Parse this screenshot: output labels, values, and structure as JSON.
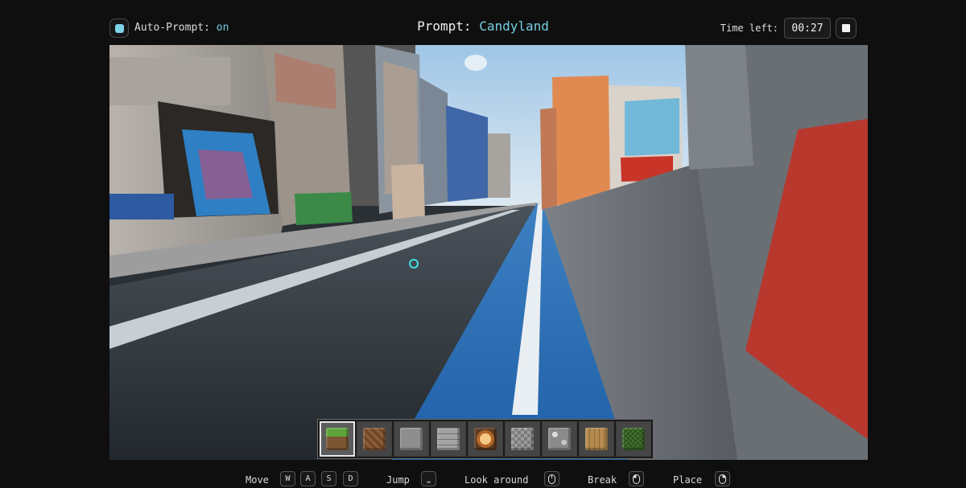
{
  "top_bar": {
    "auto_prompt_label": "Auto-Prompt:",
    "auto_prompt_value": "on",
    "prompt_label": "Prompt:",
    "prompt_value": "Candyland",
    "time_label": "Time left:",
    "time_value": "00:27"
  },
  "hotbar": {
    "selected_index": 0,
    "slots": [
      {
        "icon": "grass-block-icon"
      },
      {
        "icon": "dirt-block-icon"
      },
      {
        "icon": "stone-block-icon"
      },
      {
        "icon": "stone-brick-block-icon"
      },
      {
        "icon": "glowstone-block-icon"
      },
      {
        "icon": "cobblestone-block-icon"
      },
      {
        "icon": "ore-block-icon"
      },
      {
        "icon": "wood-plank-block-icon"
      },
      {
        "icon": "leaves-block-icon"
      }
    ]
  },
  "controls": {
    "move_label": "Move",
    "move_keys": [
      "W",
      "A",
      "S",
      "D"
    ],
    "jump_label": "Jump",
    "jump_key": "⎵",
    "look_label": "Look around",
    "break_label": "Break",
    "place_label": "Place"
  },
  "colors": {
    "accent": "#76cfe3",
    "background": "#0f0f0f",
    "bike_lane": "#2f6fb0",
    "sky": "#b9d6ec"
  }
}
